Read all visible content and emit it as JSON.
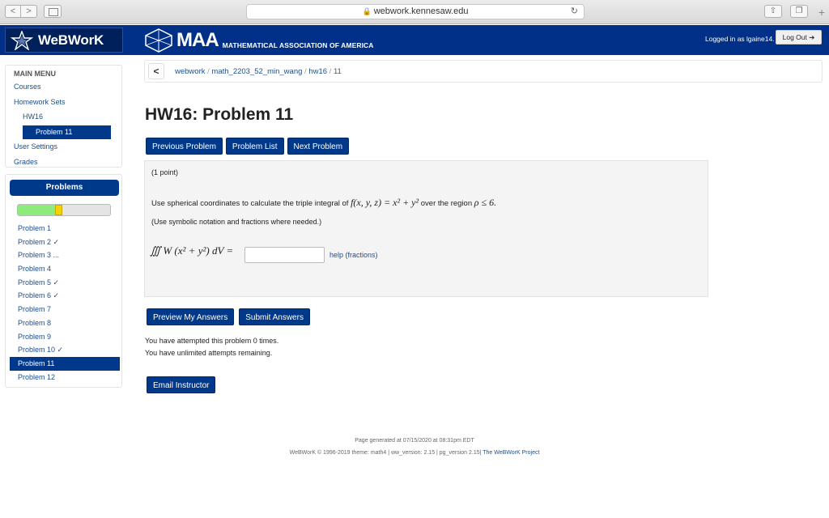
{
  "browser": {
    "url": "webwork.kennesaw.edu",
    "back_icon": "<",
    "forward_icon": ">",
    "new_tab": "+"
  },
  "header": {
    "brand": "WeBWorK",
    "maa_big": "MAA",
    "maa_small": "MATHEMATICAL ASSOCIATION OF AMERICA",
    "logged_in": "Logged in as lgaine14.",
    "logout": "Log Out ➔"
  },
  "main_menu": {
    "title": "MAIN MENU",
    "courses": "Courses",
    "homework_sets": "Homework Sets",
    "hw16": "HW16",
    "problem11": "Problem 11",
    "user_settings": "User Settings",
    "grades": "Grades"
  },
  "problems_panel": {
    "title": "Problems",
    "progress_correct_fraction": 0.4,
    "progress_current_fraction": 0.08,
    "items": [
      "Problem 1",
      "Problem 2 ✓",
      "Problem 3 ...",
      "Problem 4",
      "Problem 5 ✓",
      "Problem 6 ✓",
      "Problem 7",
      "Problem 8",
      "Problem 9",
      "Problem 10 ✓",
      "Problem 11",
      "Problem 12"
    ],
    "active_index": 10
  },
  "breadcrumb": {
    "back": "<",
    "webwork": "webwork",
    "course": "math_2203_52_min_wang",
    "set": "hw16",
    "problem": "11",
    "sep": " / "
  },
  "page": {
    "title": "HW16: Problem 11",
    "prev": "Previous Problem",
    "list": "Problem List",
    "next": "Next Problem"
  },
  "problem": {
    "points": "(1 point)",
    "q_prefix": "Use spherical coordinates to calculate the triple integral of ",
    "q_func": "f(x, y, z) = x² + y²",
    "q_mid": " over the region ",
    "q_region": "ρ ≤ 6.",
    "note": "(Use symbolic notation and fractions where needed.)",
    "integral": "∭ W (x² + y²) dV =",
    "answer_value": "",
    "help": "help (fractions)"
  },
  "actions": {
    "preview": "Preview My Answers",
    "submit": "Submit Answers",
    "attempts1": "You have attempted this problem 0 times.",
    "attempts2": "You have unlimited attempts remaining.",
    "email": "Email Instructor"
  },
  "footer": {
    "generated": "Page generated at 07/15/2020 at 08:31pm EDT",
    "line2a": "WeBWorK © 1996-2019",
    "line2b": " theme: math4 | ww_version: 2.15 | pg_version 2.15| ",
    "line2c": "The WeBWorK Project"
  }
}
